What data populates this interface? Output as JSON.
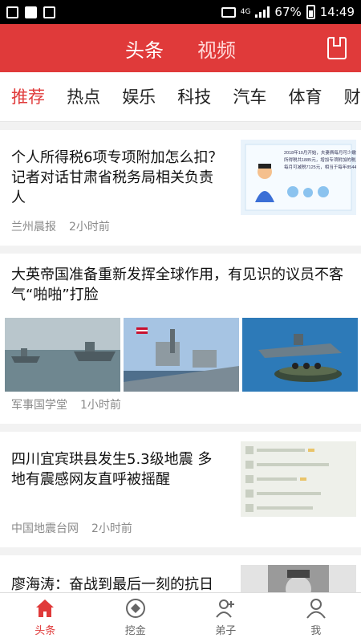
{
  "status_bar": {
    "network": "4G",
    "battery": "67%",
    "time": "14:49"
  },
  "header": {
    "tabs": [
      {
        "label": "头条",
        "active": true
      },
      {
        "label": "视频",
        "active": false
      }
    ]
  },
  "channels": [
    {
      "label": "推荐",
      "active": true
    },
    {
      "label": "热点",
      "active": false
    },
    {
      "label": "娱乐",
      "active": false
    },
    {
      "label": "科技",
      "active": false
    },
    {
      "label": "汽车",
      "active": false
    },
    {
      "label": "体育",
      "active": false
    },
    {
      "label": "财经",
      "active": false
    }
  ],
  "feed": [
    {
      "title": "个人所得税6项专项附加怎么扣？记者对话甘肃省税务局相关负责人",
      "source": "兰州晨报",
      "time": "2小时前"
    },
    {
      "title": "大英帝国准备重新发挥全球作用，有见识的议员不客气“啪啪”打脸",
      "source": "军事国学堂",
      "time": "1小时前"
    },
    {
      "title": "四川宜宾珙县发生5.3级地震 多地有震感网友直呼被摇醒",
      "source": "中国地震台网",
      "time": "2小时前"
    },
    {
      "title": "廖海涛：奋战到最后一刻的抗日英雄"
    }
  ],
  "thumb_text": {
    "line1": "2018年10月开始，夫妻俩每月可少缴个人",
    "line2": "所得税共1885元，增加专项附加的税后，",
    "line3": "每月可减税7125元，相当于每年8544元。"
  },
  "bottom_nav": [
    {
      "label": "头条",
      "icon": "home-icon",
      "active": true
    },
    {
      "label": "挖金",
      "icon": "coin-icon",
      "active": false
    },
    {
      "label": "弟子",
      "icon": "add-user-icon",
      "active": false
    },
    {
      "label": "我",
      "icon": "user-icon",
      "active": false
    }
  ],
  "colors": {
    "brand": "#e03a3a"
  }
}
